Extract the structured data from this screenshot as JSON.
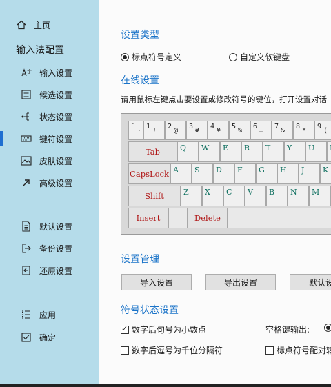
{
  "sidebar": {
    "home": {
      "label": "主页",
      "icon": "home-icon"
    },
    "section_title": "输入法配置",
    "items": [
      {
        "label": "输入设置",
        "icon": "input-settings-icon"
      },
      {
        "label": "候选设置",
        "icon": "candidate-icon"
      },
      {
        "label": "状态设置",
        "icon": "status-icon"
      },
      {
        "label": "键符设置",
        "icon": "keyboard-icon",
        "active": true
      },
      {
        "label": "皮肤设置",
        "icon": "image-icon"
      },
      {
        "label": "高级设置",
        "icon": "arrow-icon"
      }
    ],
    "group2": [
      {
        "label": "默认设置",
        "icon": "default-doc-icon"
      },
      {
        "label": "备份设置",
        "icon": "backup-icon"
      },
      {
        "label": "还原设置",
        "icon": "restore-icon"
      }
    ],
    "group3": [
      {
        "label": "应用",
        "icon": "apply-list-icon"
      },
      {
        "label": "确定",
        "icon": "confirm-check-icon"
      }
    ]
  },
  "main": {
    "type_heading": "设置类型",
    "radio_symbol": "标点符号定义",
    "radio_custom": "自定义软键盘",
    "online_heading": "在线设置",
    "description": "请用鼠标左键点击要设置或修改符号的键位，打开设置对话",
    "keyboard": {
      "row1": [
        [
          "`",
          "·"
        ],
        [
          "1",
          "!"
        ],
        [
          "2",
          "@"
        ],
        [
          "3",
          "#"
        ],
        [
          "4",
          "¥"
        ],
        [
          "5",
          "%"
        ],
        [
          "6",
          "…"
        ],
        [
          "7",
          "&"
        ],
        [
          "8",
          "*"
        ],
        [
          "9",
          "("
        ]
      ],
      "row2_func": "Tab",
      "row2": [
        "Q",
        "W",
        "E",
        "R",
        "T",
        "Y",
        "U",
        "I"
      ],
      "row3_func": "CapsLock",
      "row3": [
        "A",
        "S",
        "D",
        "F",
        "G",
        "H",
        "J",
        "K"
      ],
      "row4_func": "Shift",
      "row4": [
        "Z",
        "X",
        "C",
        "V",
        "B",
        "N",
        "M"
      ],
      "row5_insert": "Insert",
      "row5_delete": "Delete"
    },
    "manage_heading": "设置管理",
    "import_label": "导入设置",
    "export_label": "导出设置",
    "default_label": "默认设",
    "symbol_state_heading": "符号状态设置",
    "chk_decimal": "数字后句号为小数点",
    "space_output_label": "空格键输出:",
    "chk_thousand": "数字后逗号为千位分隔符",
    "chk_pair": "标点符号配对输"
  }
}
